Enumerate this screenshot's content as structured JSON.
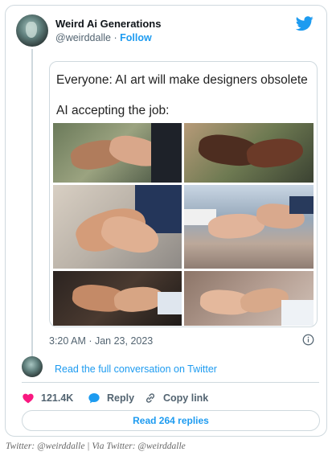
{
  "tweet": {
    "display_name": "Weird Ai Generations",
    "handle": "@weirddalle",
    "separator": "·",
    "follow_label": "Follow",
    "image_text_line1": "Everyone: AI art will make designers obsolete",
    "image_text_line2": "AI accepting the job:",
    "timestamp": "3:20 AM · Jan 23, 2023",
    "read_conversation_label": "Read the full conversation on Twitter",
    "likes_count": "121.4K",
    "reply_label": "Reply",
    "copy_link_label": "Copy link",
    "read_replies_label": "Read 264 replies"
  },
  "caption": "Twitter: @weirddalle | Via Twitter: @weirddalle",
  "colors": {
    "accent": "#1d9bf0",
    "like": "#f91880",
    "text_secondary": "#536471",
    "border": "#cfd9de"
  },
  "icons": {
    "brand": "twitter-bird-icon",
    "info": "info-icon",
    "like": "heart-icon",
    "reply": "reply-bubble-icon",
    "copy_link": "link-icon"
  }
}
